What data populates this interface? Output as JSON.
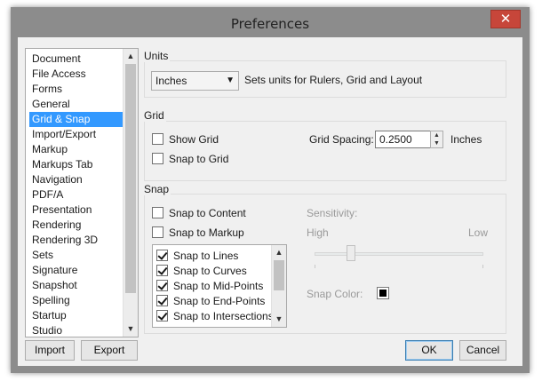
{
  "window": {
    "title": "Preferences",
    "close_glyph": "✕"
  },
  "categories": {
    "items": [
      "Document",
      "File Access",
      "Forms",
      "General",
      "Grid & Snap",
      "Import/Export",
      "Markup",
      "Markups Tab",
      "Navigation",
      "PDF/A",
      "Presentation",
      "Rendering",
      "Rendering 3D",
      "Sets",
      "Signature",
      "Snapshot",
      "Spelling",
      "Startup",
      "Studio"
    ],
    "selected": "Grid & Snap"
  },
  "units": {
    "group_label": "Units",
    "select_value": "Inches",
    "description": "Sets units for Rulers, Grid and Layout"
  },
  "grid": {
    "group_label": "Grid",
    "show_grid": {
      "label": "Show Grid",
      "checked": false
    },
    "snap_to_grid": {
      "label": "Snap to Grid",
      "checked": false
    },
    "spacing_label": "Grid Spacing:",
    "spacing_value": "0.2500",
    "spacing_unit": "Inches"
  },
  "snap": {
    "group_label": "Snap",
    "snap_to_content": {
      "label": "Snap to Content",
      "checked": false
    },
    "snap_to_markup": {
      "label": "Snap to Markup",
      "checked": false
    },
    "options": [
      {
        "label": "Snap to Lines",
        "checked": true
      },
      {
        "label": "Snap to Curves",
        "checked": true
      },
      {
        "label": "Snap to Mid-Points",
        "checked": true
      },
      {
        "label": "Snap to End-Points",
        "checked": true
      },
      {
        "label": "Snap to Intersections",
        "checked": true
      }
    ],
    "sensitivity_label": "Sensitivity:",
    "high_label": "High",
    "low_label": "Low",
    "sensitivity_level": 0.2,
    "snap_color_label": "Snap Color:",
    "snap_color": "#000000"
  },
  "buttons": {
    "import": "Import",
    "export": "Export",
    "ok": "OK",
    "cancel": "Cancel"
  },
  "colors": {
    "selection": "#3399ff",
    "frame": "#8c8c8c",
    "close_button": "#c7463a"
  }
}
